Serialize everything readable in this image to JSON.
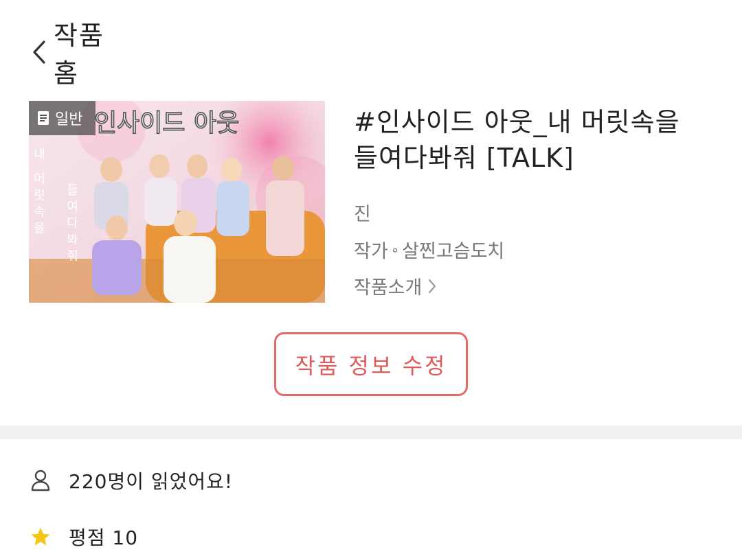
{
  "header": {
    "title": "작품 홈"
  },
  "cover": {
    "badge": "일반",
    "cover_text_top": "인사이드 아웃",
    "cover_text_left": "내 머릿속을",
    "cover_text_right": "들여다봐줘"
  },
  "work": {
    "title": "#인사이드 아웃_내 머릿속을 들여다봐줘 [TALK]",
    "genre": "진",
    "author_label": "작가",
    "author_sep": "∘",
    "author_name": "살찐고슴도치",
    "intro_link": "작품소개"
  },
  "actions": {
    "edit_label": "작품 정보 수정"
  },
  "stats": {
    "reads": "220명이 읽었어요!",
    "rating": "평점 10"
  },
  "colors": {
    "accent": "#e05a5a",
    "star": "#f5c518",
    "divider": "#f1f1f3"
  }
}
